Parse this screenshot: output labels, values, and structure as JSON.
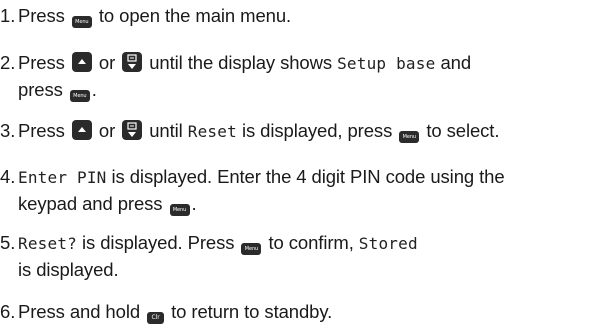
{
  "keys": {
    "menu": "Menu",
    "clear": "Clr"
  },
  "steps": [
    {
      "num": "1.",
      "t1": "Press",
      "t2": "to open the main menu."
    },
    {
      "num": "2.",
      "t1": "Press",
      "t2": "or",
      "t3": "until the display shows",
      "lcd1": "Setup base",
      "t4": "and",
      "t5": "press",
      "t6": "."
    },
    {
      "num": "3.",
      "t1": "Press",
      "t2": "or",
      "t3": "until",
      "lcd1": "Reset",
      "t4": "is displayed, press",
      "t5": "to select."
    },
    {
      "num": "4.",
      "lcd1": "Enter PIN",
      "t1": "is displayed. Enter the 4 digit PIN code using the",
      "t2": "keypad and press",
      "t3": "."
    },
    {
      "num": "5.",
      "lcd1": "Reset?",
      "t1": "is displayed. Press",
      "t2": "to confirm,",
      "lcd2": "Stored",
      "t3": "is displayed."
    },
    {
      "num": "6.",
      "t1": "Press and hold",
      "t2": "to return to standby."
    }
  ]
}
